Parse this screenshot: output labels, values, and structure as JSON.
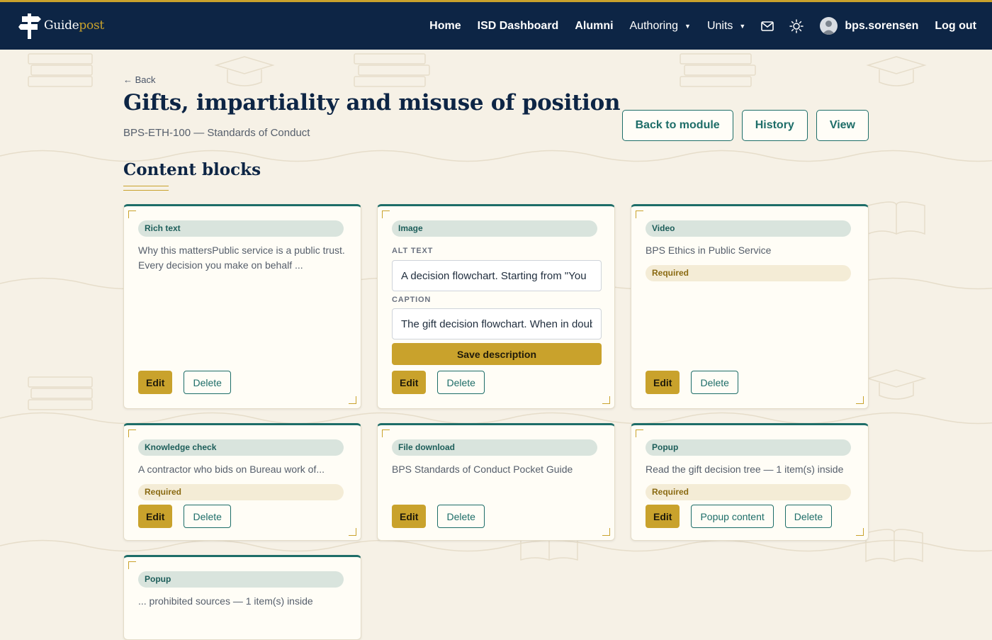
{
  "brand": {
    "name_main": "Guide",
    "name_accent": "post"
  },
  "nav": {
    "home": "Home",
    "isd_dashboard": "ISD Dashboard",
    "alumni": "Alumni",
    "authoring": "Authoring",
    "units": "Units",
    "username": "bps.sorensen",
    "logout": "Log out"
  },
  "page": {
    "back": "← Back",
    "title": "Gifts, impartiality and misuse of position",
    "subtitle": "BPS-ETH-100 — Standards of Conduct",
    "actions": {
      "back_to_module": "Back to module",
      "history": "History",
      "view": "View"
    },
    "section_title": "Content blocks"
  },
  "labels": {
    "edit": "Edit",
    "delete": "Delete",
    "required": "Required",
    "popup_content": "Popup content",
    "alt_text": "ALT TEXT",
    "caption": "CAPTION",
    "save_description": "Save description"
  },
  "blocks": [
    {
      "type": "Rich text",
      "description": "Why this mattersPublic service is a public trust. Every decision you make on behalf ..."
    },
    {
      "type": "Image",
      "alt_text": "A decision flowchart. Starting from \"You",
      "caption": "The gift decision flowchart. When in doubt"
    },
    {
      "type": "Video",
      "description": "BPS Ethics in Public Service",
      "required": true
    },
    {
      "type": "Knowledge check",
      "description": "A contractor who bids on Bureau work of...",
      "required": true
    },
    {
      "type": "File download",
      "description": "BPS Standards of Conduct Pocket Guide"
    },
    {
      "type": "Popup",
      "description": "Read the gift decision tree — 1 item(s) inside",
      "required": true
    },
    {
      "type": "Popup",
      "description": "... prohibited sources — 1 item(s) inside"
    }
  ],
  "colors": {
    "navy": "#0d2545",
    "gold": "#c9a22c",
    "teal": "#1d6d68",
    "page_bg": "#f6f1e6"
  }
}
